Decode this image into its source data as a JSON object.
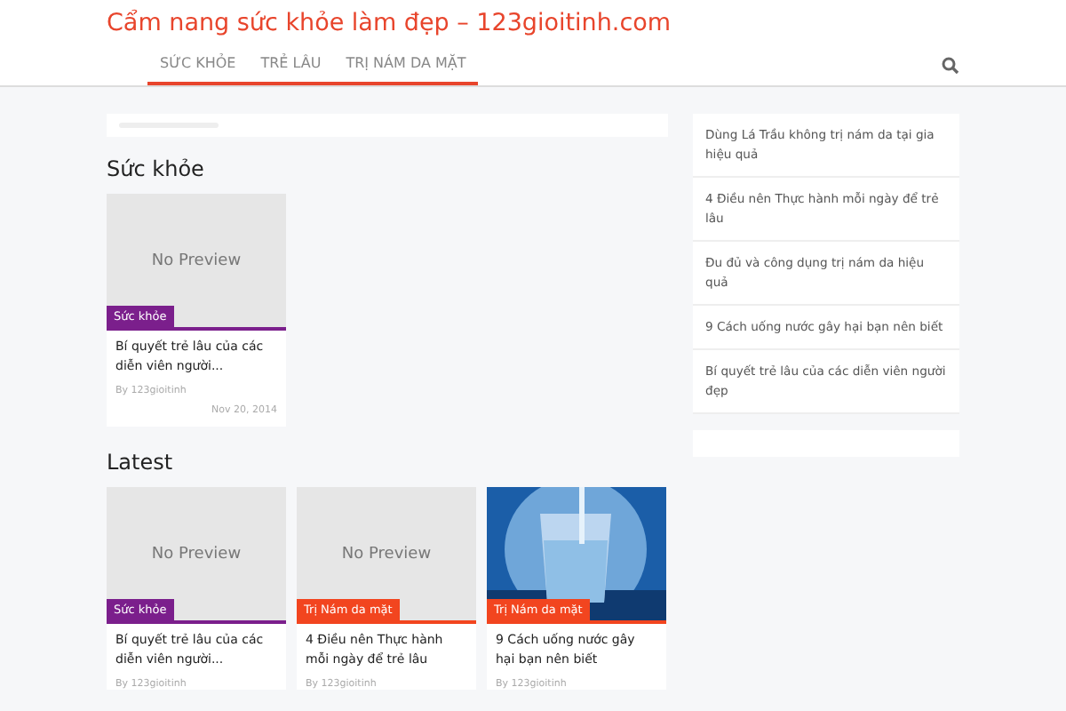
{
  "site_title": "Cẩm nang sức khỏe làm đẹp – 123gioitinh.com",
  "nav": [
    {
      "label": "SỨC KHỎE",
      "selected": true
    },
    {
      "label": "TRẺ LÂU",
      "selected": true
    },
    {
      "label": "TRỊ NÁM DA MẶT",
      "selected": true
    }
  ],
  "sections": [
    {
      "heading": "Sức khỏe",
      "cards": [
        {
          "image": {
            "kind": "no_preview",
            "text": "No Preview"
          },
          "category": "Sức khỏe",
          "color": "#7b1f8c",
          "title": "Bí quyết trẻ lâu của các diễn viên người...",
          "author": "By 123gioitinh",
          "date": "Nov 20, 2014"
        }
      ]
    },
    {
      "heading": "Latest",
      "cards": [
        {
          "image": {
            "kind": "no_preview",
            "text": "No Preview"
          },
          "category": "Sức khỏe",
          "color": "#7b1f8c",
          "title": "Bí quyết trẻ lâu của các diễn viên người...",
          "author": "By 123gioitinh"
        },
        {
          "image": {
            "kind": "no_preview",
            "text": "No Preview"
          },
          "category": "Trị Nám da mặt",
          "color": "#f2451f",
          "title": "4 Điều nên Thực hành mỗi ngày để trẻ lâu",
          "author": "By 123gioitinh"
        },
        {
          "category": "Trị Nám da mặt",
          "color": "#f2451f",
          "title": "9 Cách uống nước gây hại bạn nên biết",
          "author": "By 123gioitinh"
        }
      ]
    }
  ],
  "sidebar": {
    "items": [
      "Dùng Lá Trầu không trị nám da tại gia hiệu quả",
      "4 Điều nên Thực hành mỗi ngày để trẻ lâu",
      "Đu đủ và công dụng trị nám da hiệu quả",
      "9 Cách uống nước gây hại bạn nên biết",
      "Bí quyết trẻ lâu của các diễn viên người đẹp"
    ]
  }
}
